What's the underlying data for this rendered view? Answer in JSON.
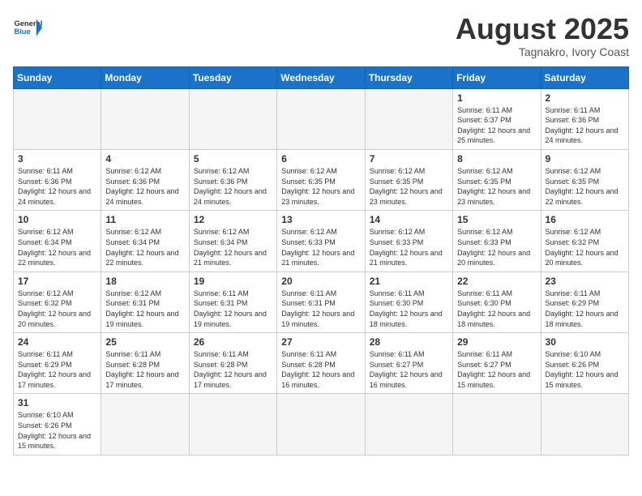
{
  "header": {
    "logo_general": "General",
    "logo_blue": "Blue",
    "month_title": "August 2025",
    "location": "Tagnakro, Ivory Coast"
  },
  "days_of_week": [
    "Sunday",
    "Monday",
    "Tuesday",
    "Wednesday",
    "Thursday",
    "Friday",
    "Saturday"
  ],
  "weeks": [
    [
      {
        "day": "",
        "info": ""
      },
      {
        "day": "",
        "info": ""
      },
      {
        "day": "",
        "info": ""
      },
      {
        "day": "",
        "info": ""
      },
      {
        "day": "",
        "info": ""
      },
      {
        "day": "1",
        "info": "Sunrise: 6:11 AM\nSunset: 6:37 PM\nDaylight: 12 hours and 25 minutes."
      },
      {
        "day": "2",
        "info": "Sunrise: 6:11 AM\nSunset: 6:36 PM\nDaylight: 12 hours and 24 minutes."
      }
    ],
    [
      {
        "day": "3",
        "info": "Sunrise: 6:11 AM\nSunset: 6:36 PM\nDaylight: 12 hours and 24 minutes."
      },
      {
        "day": "4",
        "info": "Sunrise: 6:12 AM\nSunset: 6:36 PM\nDaylight: 12 hours and 24 minutes."
      },
      {
        "day": "5",
        "info": "Sunrise: 6:12 AM\nSunset: 6:36 PM\nDaylight: 12 hours and 24 minutes."
      },
      {
        "day": "6",
        "info": "Sunrise: 6:12 AM\nSunset: 6:35 PM\nDaylight: 12 hours and 23 minutes."
      },
      {
        "day": "7",
        "info": "Sunrise: 6:12 AM\nSunset: 6:35 PM\nDaylight: 12 hours and 23 minutes."
      },
      {
        "day": "8",
        "info": "Sunrise: 6:12 AM\nSunset: 6:35 PM\nDaylight: 12 hours and 23 minutes."
      },
      {
        "day": "9",
        "info": "Sunrise: 6:12 AM\nSunset: 6:35 PM\nDaylight: 12 hours and 22 minutes."
      }
    ],
    [
      {
        "day": "10",
        "info": "Sunrise: 6:12 AM\nSunset: 6:34 PM\nDaylight: 12 hours and 22 minutes."
      },
      {
        "day": "11",
        "info": "Sunrise: 6:12 AM\nSunset: 6:34 PM\nDaylight: 12 hours and 22 minutes."
      },
      {
        "day": "12",
        "info": "Sunrise: 6:12 AM\nSunset: 6:34 PM\nDaylight: 12 hours and 21 minutes."
      },
      {
        "day": "13",
        "info": "Sunrise: 6:12 AM\nSunset: 6:33 PM\nDaylight: 12 hours and 21 minutes."
      },
      {
        "day": "14",
        "info": "Sunrise: 6:12 AM\nSunset: 6:33 PM\nDaylight: 12 hours and 21 minutes."
      },
      {
        "day": "15",
        "info": "Sunrise: 6:12 AM\nSunset: 6:33 PM\nDaylight: 12 hours and 20 minutes."
      },
      {
        "day": "16",
        "info": "Sunrise: 6:12 AM\nSunset: 6:32 PM\nDaylight: 12 hours and 20 minutes."
      }
    ],
    [
      {
        "day": "17",
        "info": "Sunrise: 6:12 AM\nSunset: 6:32 PM\nDaylight: 12 hours and 20 minutes."
      },
      {
        "day": "18",
        "info": "Sunrise: 6:12 AM\nSunset: 6:31 PM\nDaylight: 12 hours and 19 minutes."
      },
      {
        "day": "19",
        "info": "Sunrise: 6:11 AM\nSunset: 6:31 PM\nDaylight: 12 hours and 19 minutes."
      },
      {
        "day": "20",
        "info": "Sunrise: 6:11 AM\nSunset: 6:31 PM\nDaylight: 12 hours and 19 minutes."
      },
      {
        "day": "21",
        "info": "Sunrise: 6:11 AM\nSunset: 6:30 PM\nDaylight: 12 hours and 18 minutes."
      },
      {
        "day": "22",
        "info": "Sunrise: 6:11 AM\nSunset: 6:30 PM\nDaylight: 12 hours and 18 minutes."
      },
      {
        "day": "23",
        "info": "Sunrise: 6:11 AM\nSunset: 6:29 PM\nDaylight: 12 hours and 18 minutes."
      }
    ],
    [
      {
        "day": "24",
        "info": "Sunrise: 6:11 AM\nSunset: 6:29 PM\nDaylight: 12 hours and 17 minutes."
      },
      {
        "day": "25",
        "info": "Sunrise: 6:11 AM\nSunset: 6:28 PM\nDaylight: 12 hours and 17 minutes."
      },
      {
        "day": "26",
        "info": "Sunrise: 6:11 AM\nSunset: 6:28 PM\nDaylight: 12 hours and 17 minutes."
      },
      {
        "day": "27",
        "info": "Sunrise: 6:11 AM\nSunset: 6:28 PM\nDaylight: 12 hours and 16 minutes."
      },
      {
        "day": "28",
        "info": "Sunrise: 6:11 AM\nSunset: 6:27 PM\nDaylight: 12 hours and 16 minutes."
      },
      {
        "day": "29",
        "info": "Sunrise: 6:11 AM\nSunset: 6:27 PM\nDaylight: 12 hours and 15 minutes."
      },
      {
        "day": "30",
        "info": "Sunrise: 6:10 AM\nSunset: 6:26 PM\nDaylight: 12 hours and 15 minutes."
      }
    ],
    [
      {
        "day": "31",
        "info": "Sunrise: 6:10 AM\nSunset: 6:26 PM\nDaylight: 12 hours and 15 minutes."
      },
      {
        "day": "",
        "info": ""
      },
      {
        "day": "",
        "info": ""
      },
      {
        "day": "",
        "info": ""
      },
      {
        "day": "",
        "info": ""
      },
      {
        "day": "",
        "info": ""
      },
      {
        "day": "",
        "info": ""
      }
    ]
  ]
}
